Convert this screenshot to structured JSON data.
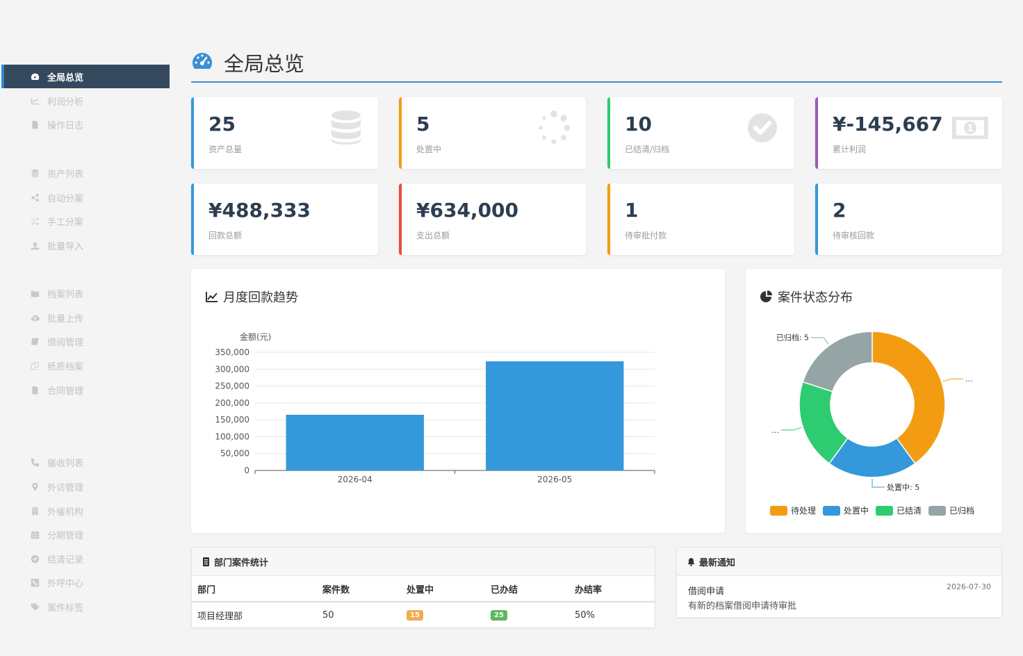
{
  "sidebar": {
    "items": [
      {
        "label": "全局总览",
        "icon": "dashboard-icon",
        "active": true
      },
      {
        "label": "利润分析",
        "icon": "line-chart-icon"
      },
      {
        "label": "操作日志",
        "icon": "file-icon"
      },
      {
        "label": "资产列表",
        "icon": "database-icon"
      },
      {
        "label": "自动分案",
        "icon": "share-icon"
      },
      {
        "label": "手工分案",
        "icon": "shuffle-icon"
      },
      {
        "label": "批量导入",
        "icon": "upload-icon"
      },
      {
        "label": "档案列表",
        "icon": "folder-icon"
      },
      {
        "label": "批量上传",
        "icon": "cloud-upload-icon"
      },
      {
        "label": "借阅管理",
        "icon": "book-icon"
      },
      {
        "label": "纸质档案",
        "icon": "copy-icon"
      },
      {
        "label": "合同管理",
        "icon": "file-icon"
      },
      {
        "label": "催收列表",
        "icon": "phone-icon"
      },
      {
        "label": "外访管理",
        "icon": "map-marker-icon"
      },
      {
        "label": "外催机构",
        "icon": "building-icon"
      },
      {
        "label": "分期管理",
        "icon": "calendar-icon"
      },
      {
        "label": "结清记录",
        "icon": "check-circle-icon"
      },
      {
        "label": "外呼中心",
        "icon": "phone-square-icon"
      },
      {
        "label": "案件标签",
        "icon": "tags-icon"
      }
    ]
  },
  "header": {
    "title": "全局总览",
    "icon": "dashboard-icon"
  },
  "stats": [
    {
      "value": "25",
      "label": "资产总量",
      "color": "#3498db",
      "icon": "database-icon"
    },
    {
      "value": "5",
      "label": "处置中",
      "color": "#f39c12",
      "icon": "spinner-icon"
    },
    {
      "value": "10",
      "label": "已结清/归档",
      "color": "#2ecc71",
      "icon": "check-circle-icon"
    },
    {
      "value": "¥-145,667",
      "label": "累计利润",
      "color": "#9b59b6",
      "icon": "money-icon"
    },
    {
      "value": "¥488,333",
      "label": "回款总额",
      "color": "#3498db"
    },
    {
      "value": "¥634,000",
      "label": "支出总额",
      "color": "#e74c3c"
    },
    {
      "value": "1",
      "label": "待审批付款",
      "color": "#f39c12"
    },
    {
      "value": "2",
      "label": "待审核回款",
      "color": "#3498db"
    }
  ],
  "trend_panel": {
    "title": "月度回款趋势",
    "icon": "line-chart-icon"
  },
  "status_panel": {
    "title": "案件状态分布",
    "icon": "pie-chart-icon"
  },
  "chart_data": [
    {
      "type": "bar",
      "title": "",
      "ylabel": "金额(元)",
      "xlabel": "",
      "categories": [
        "2026-04",
        "2026-05"
      ],
      "values": [
        165000,
        323333
      ],
      "ylim": [
        0,
        350000
      ],
      "yticks": [
        0,
        50000,
        100000,
        150000,
        200000,
        250000,
        300000,
        350000
      ],
      "ytick_labels": [
        "0",
        "50,000",
        "100,000",
        "150,000",
        "200,000",
        "250,000",
        "300,000",
        "350,000"
      ],
      "grid": true,
      "color": "#3498db"
    },
    {
      "type": "pie",
      "donut": true,
      "labels": [
        "待处理",
        "处置中",
        "已结清",
        "已归档"
      ],
      "values": [
        10,
        5,
        5,
        5
      ],
      "colors": [
        "#f39c12",
        "#3498db",
        "#2ecc71",
        "#95a5a6"
      ],
      "callouts": [
        "...",
        "处置中: 5",
        "...",
        "已归档: 5"
      ],
      "legend": "bottom"
    }
  ],
  "dept_table": {
    "title": "部门案件统计",
    "icon": "list-icon",
    "columns": [
      "部门",
      "案件数",
      "处置中",
      "已办结",
      "办结率"
    ],
    "rows": [
      {
        "dept": "项目经理部",
        "count": "50",
        "processing": "15",
        "done": "25",
        "rate": "50%"
      }
    ]
  },
  "notices": {
    "title": "最新通知",
    "icon": "bell-icon",
    "items": [
      {
        "title": "借阅申请",
        "desc": "有新的档案借阅申请待审批",
        "date": "2026-07-30"
      }
    ]
  }
}
